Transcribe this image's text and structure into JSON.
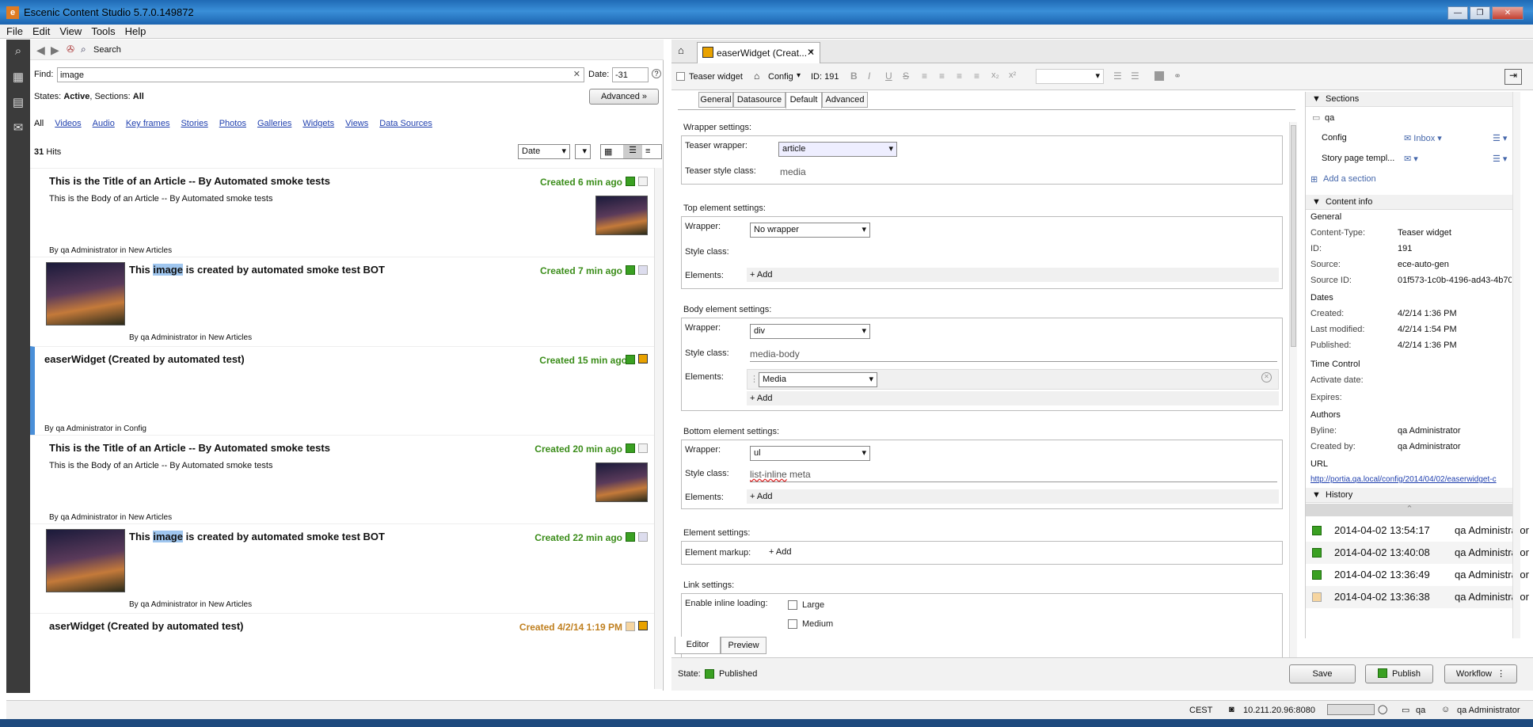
{
  "window": {
    "title": "Escenic Content Studio 5.7.0.149872"
  },
  "menu": [
    "File",
    "Edit",
    "View",
    "Tools",
    "Help"
  ],
  "search": {
    "button": "Search",
    "find_label": "Find:",
    "find_value": "image",
    "date_label": "Date:",
    "date_value": "-31",
    "states_label": "States:",
    "states_value": "Active",
    "sections_label": "Sections:",
    "sections_value": "All",
    "advanced": "Advanced",
    "filters": [
      "All",
      "Videos",
      "Audio",
      "Key frames",
      "Stories",
      "Photos",
      "Galleries",
      "Widgets",
      "Views",
      "Data Sources"
    ],
    "hits": "31",
    "hits_label": "Hits",
    "sort": "Date"
  },
  "results": [
    {
      "title": "This is the Title of an Article -- By Automated smoke tests",
      "body": "This is the Body of an Article -- By Automated smoke tests",
      "created": "Created 6 min ago",
      "by": "By",
      "author": "qa Administrator",
      "in": "in",
      "section": "New Articles"
    },
    {
      "title_pre": "This",
      "title_hl": "image",
      "title_post": "is created by automated smoke test BOT",
      "created": "Created 7 min ago",
      "by": "By",
      "author": "qa Administrator",
      "in": "in",
      "section": "New Articles"
    },
    {
      "title": "easerWidget (Created by automated test)",
      "created": "Created 15 min ago",
      "by": "By",
      "author": "qa Administrator",
      "in": "in",
      "section": "Config"
    },
    {
      "title": "This is the Title of an Article -- By Automated smoke tests",
      "body": "This is the Body of an Article -- By Automated smoke tests",
      "created": "Created 20 min ago",
      "by": "By",
      "author": "qa Administrator",
      "in": "in",
      "section": "New Articles"
    },
    {
      "title_pre": "This",
      "title_hl": "image",
      "title_post": "is created by automated smoke test BOT",
      "created": "Created 22 min ago",
      "by": "By",
      "author": "qa Administrator",
      "in": "in",
      "section": "New Articles"
    },
    {
      "title": "aserWidget (Created by automated test)",
      "created": "Created 4/2/14 1:19 PM"
    }
  ],
  "editor": {
    "tab_title": "easerWidget (Creat... *",
    "type_label": "Teaser widget",
    "config_label": "Config",
    "id_label": "ID: 191",
    "subtabs": [
      "General",
      "Datasource",
      "Default",
      "Advanced"
    ],
    "wrapper_settings": "Wrapper settings:",
    "teaser_wrapper_label": "Teaser wrapper:",
    "teaser_wrapper_value": "article",
    "teaser_style_label": "Teaser style class:",
    "teaser_style_value": "media",
    "top_settings": "Top element settings:",
    "wrapper_label": "Wrapper:",
    "style_class_label": "Style class:",
    "elements_label": "Elements:",
    "top_wrapper_value": "No wrapper",
    "add": "+ Add",
    "body_settings": "Body element settings:",
    "body_wrapper_value": "div",
    "body_style_value": "media-body",
    "body_element_value": "Media",
    "bottom_settings": "Bottom element settings:",
    "bottom_wrapper_value": "ul",
    "bottom_style_value_1": "list-inline",
    "bottom_style_value_2": "meta",
    "element_settings": "Element settings:",
    "element_markup_label": "Element markup:",
    "link_settings": "Link settings:",
    "inline_loading_label": "Enable inline loading:",
    "inline_options": [
      "Large",
      "Medium"
    ],
    "bottom_tabs": [
      "Editor",
      "Preview"
    ],
    "state_label": "State:",
    "state_value": "Published",
    "save": "Save",
    "publish": "Publish",
    "workflow": "Workflow"
  },
  "sidebar": {
    "sections_title": "Sections",
    "section_name": "qa",
    "rows": [
      {
        "name": "Config",
        "value": "Inbox"
      },
      {
        "name": "Story page templ...",
        "value": ""
      }
    ],
    "add_section": "Add a section",
    "content_info_title": "Content info",
    "general_title": "General",
    "general": [
      {
        "k": "Content-Type:",
        "v": "Teaser widget"
      },
      {
        "k": "ID:",
        "v": "191"
      },
      {
        "k": "Source:",
        "v": "ece-auto-gen"
      },
      {
        "k": "Source ID:",
        "v": "01f573-1c0b-4196-ad43-4b70"
      }
    ],
    "dates_title": "Dates",
    "dates": [
      {
        "k": "Created:",
        "v": "4/2/14 1:36 PM"
      },
      {
        "k": "Last modified:",
        "v": "4/2/14 1:54 PM"
      },
      {
        "k": "Published:",
        "v": "4/2/14 1:36 PM"
      }
    ],
    "time_title": "Time Control",
    "time": [
      {
        "k": "Activate date:",
        "v": ""
      },
      {
        "k": "Expires:",
        "v": ""
      }
    ],
    "authors_title": "Authors",
    "authors": [
      {
        "k": "Byline:",
        "v": "qa Administrator"
      },
      {
        "k": "Created by:",
        "v": "qa Administrator"
      }
    ],
    "url_title": "URL",
    "url": "http://portia.qa.local/config/2014/04/02/easerwidget-c",
    "history_title": "History",
    "history": [
      {
        "date": "2014-04-02 13:54:17",
        "user": "qa Administrator"
      },
      {
        "date": "2014-04-02 13:40:08",
        "user": "qa Administrator"
      },
      {
        "date": "2014-04-02 13:36:49",
        "user": "qa Administrator"
      },
      {
        "date": "2014-04-02 13:36:38",
        "user": "qa Administrator"
      }
    ]
  },
  "status": {
    "tz": "CEST",
    "server": "10.211.20.96:8080",
    "pub": "qa",
    "user": "qa Administrator"
  }
}
